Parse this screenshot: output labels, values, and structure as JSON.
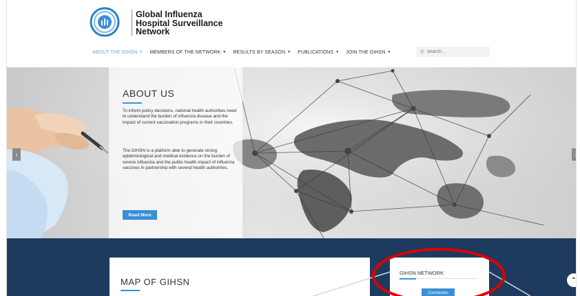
{
  "brand": {
    "line1": "Global Influenza",
    "line2": "Hospital Surveillance",
    "line3": "Network",
    "accent": "#3a8fd6",
    "navy": "#1e3a5f"
  },
  "nav": {
    "items": [
      {
        "label": "ABOUT THE GIHSN",
        "active": true
      },
      {
        "label": "MEMBERS OF THE NETWORK"
      },
      {
        "label": "RESULTS BY SEASON"
      },
      {
        "label": "PUBLICATIONS"
      },
      {
        "label": "JOIN THE GIHSN"
      }
    ],
    "search_placeholder": "search..."
  },
  "hero": {
    "title": "ABOUT US",
    "para1": "To inform policy decisions, national health authorities need to understand the burden of influenza disease and the impact of current vaccination programs in their countries.",
    "para2": "The GIHSN is a platform able to generate strong epidemiological and medical evidence on the burden of severe influenza and the public health impact of influenza vaccines in partnership with several health authorities.",
    "button": "Read More",
    "prev_icon": "chevron-left-icon",
    "next_icon": "chevron-right-icon"
  },
  "sections": {
    "map_title": "MAP OF GIHSN",
    "network_title": "GIHSN NETWORK",
    "network_button": "Connexion"
  },
  "annotation": {
    "highlight_color": "#e00000"
  }
}
